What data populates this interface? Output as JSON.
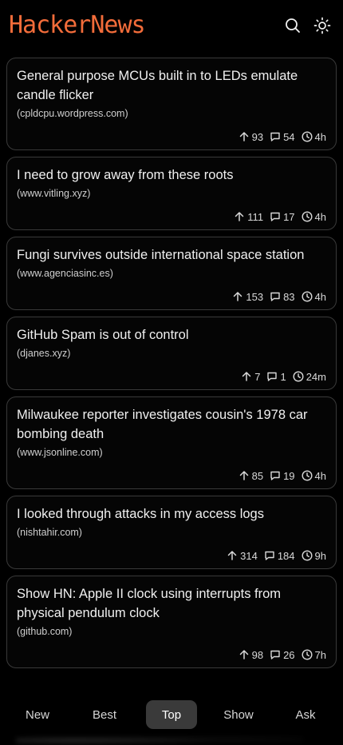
{
  "app": {
    "title": "HackerNews"
  },
  "header": {
    "search_icon": "search-icon",
    "theme_icon": "sun-icon"
  },
  "stories": [
    {
      "title": "General purpose MCUs built in to LEDs emulate candle flicker",
      "domain": "(cpldcpu.wordpress.com)",
      "points": "93",
      "comments": "54",
      "age": "4h"
    },
    {
      "title": "I need to grow away from these roots",
      "domain": "(www.vitling.xyz)",
      "points": "111",
      "comments": "17",
      "age": "4h"
    },
    {
      "title": "Fungi survives outside international space station",
      "domain": "(www.agenciasinc.es)",
      "points": "153",
      "comments": "83",
      "age": "4h"
    },
    {
      "title": "GitHub Spam is out of control",
      "domain": "(djanes.xyz)",
      "points": "7",
      "comments": "1",
      "age": "24m"
    },
    {
      "title": "Milwaukee reporter investigates cousin's 1978 car bombing death",
      "domain": "(www.jsonline.com)",
      "points": "85",
      "comments": "19",
      "age": "4h"
    },
    {
      "title": "I looked through attacks in my access logs",
      "domain": "(nishtahir.com)",
      "points": "314",
      "comments": "184",
      "age": "9h"
    },
    {
      "title": "Show HN: Apple II clock using interrupts from physical pendulum clock",
      "domain": "(github.com)",
      "points": "98",
      "comments": "26",
      "age": "7h"
    }
  ],
  "tabs": [
    {
      "label": "New",
      "active": false
    },
    {
      "label": "Best",
      "active": false
    },
    {
      "label": "Top",
      "active": true
    },
    {
      "label": "Show",
      "active": false
    },
    {
      "label": "Ask",
      "active": false
    }
  ],
  "colors": {
    "brand": "#f26c3a",
    "background": "#000000",
    "card_border": "#3a3a3a",
    "active_tab": "#3a3a3a"
  }
}
